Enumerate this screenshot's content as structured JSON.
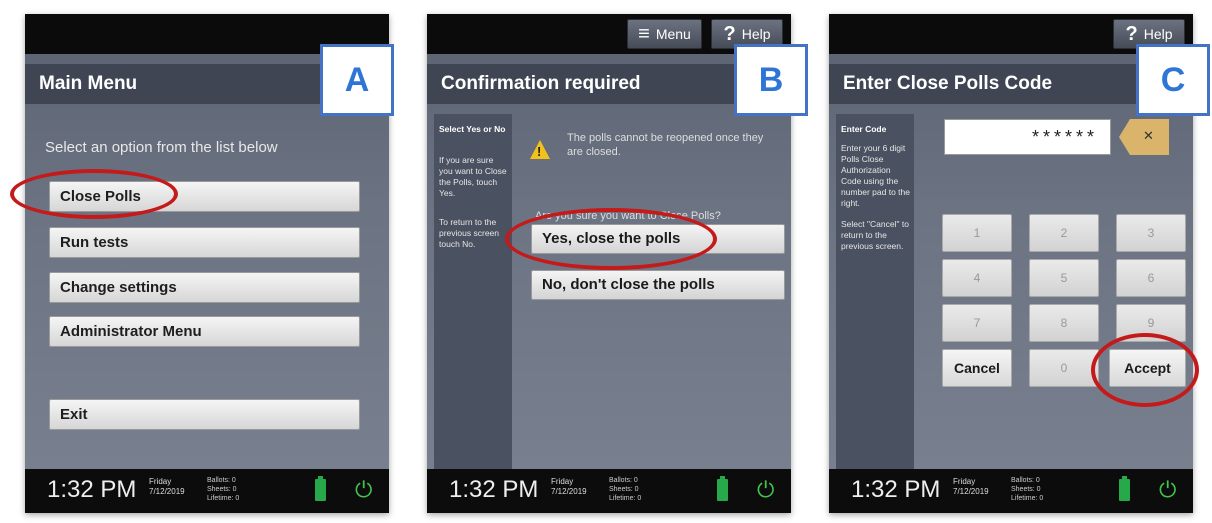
{
  "footer": {
    "time": "1:32 PM",
    "day": "Friday",
    "date": "7/12/2019",
    "ballots": "Ballots:  0",
    "sheets": "Sheets:  0",
    "lifetime": "Lifetime:  0"
  },
  "panel_a": {
    "badge": "A",
    "title": "Main Menu",
    "prompt": "Select an option from the list below",
    "buttons": [
      "Close Polls",
      "Run tests",
      "Change settings",
      "Administrator Menu",
      "Exit"
    ]
  },
  "panel_b": {
    "badge": "B",
    "menu_label": "Menu",
    "help_label": "Help",
    "title": "Confirmation required",
    "side_heading": "Select Yes or No",
    "side_p1": "If you are sure you want to Close the Polls, touch Yes.",
    "side_p2": "To return to the previous screen touch No.",
    "warning": "The polls cannot be reopened once they are closed.",
    "question": "Are you sure you want to Close Polls?",
    "yes_label": "Yes, close the polls",
    "no_label": "No, don't close the polls"
  },
  "panel_c": {
    "badge": "C",
    "help_label": "Help",
    "title": "Enter Close Polls Code",
    "side_heading": "Enter Code",
    "side_p1": "Enter your 6 digit Polls Close Authorization Code using the number pad to the right.",
    "side_p2": "Select \"Cancel\" to return to the previous screen.",
    "code_mask": "******",
    "keys": [
      "1",
      "2",
      "3",
      "4",
      "5",
      "6",
      "7",
      "8",
      "9"
    ],
    "zero": "0",
    "cancel_label": "Cancel",
    "accept_label": "Accept"
  },
  "colors": {
    "highlight_circle": "#c41a1a",
    "badge_border": "#4472c4",
    "battery": "#27a84a"
  }
}
